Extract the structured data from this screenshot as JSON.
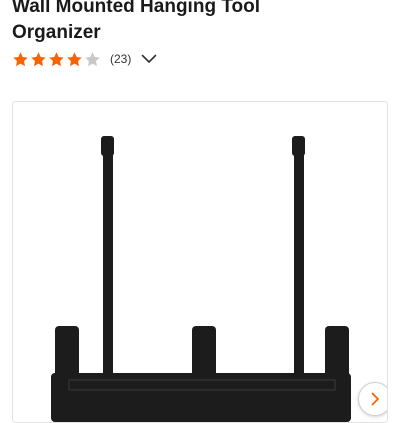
{
  "product": {
    "title_line_1": "Wall Mounted Hanging Tool",
    "title_line_2": "Organizer"
  },
  "rating": {
    "stars_filled": 4,
    "stars_total": 5,
    "review_count": "(23)",
    "star_color": "#f96302",
    "star_empty_color": "#c8c8c8"
  },
  "icons": {
    "expand": "chevron-down-icon",
    "next": "chevron-right-icon"
  },
  "colors": {
    "next_arrow": "#f96302",
    "product": "#1c1c1c"
  }
}
